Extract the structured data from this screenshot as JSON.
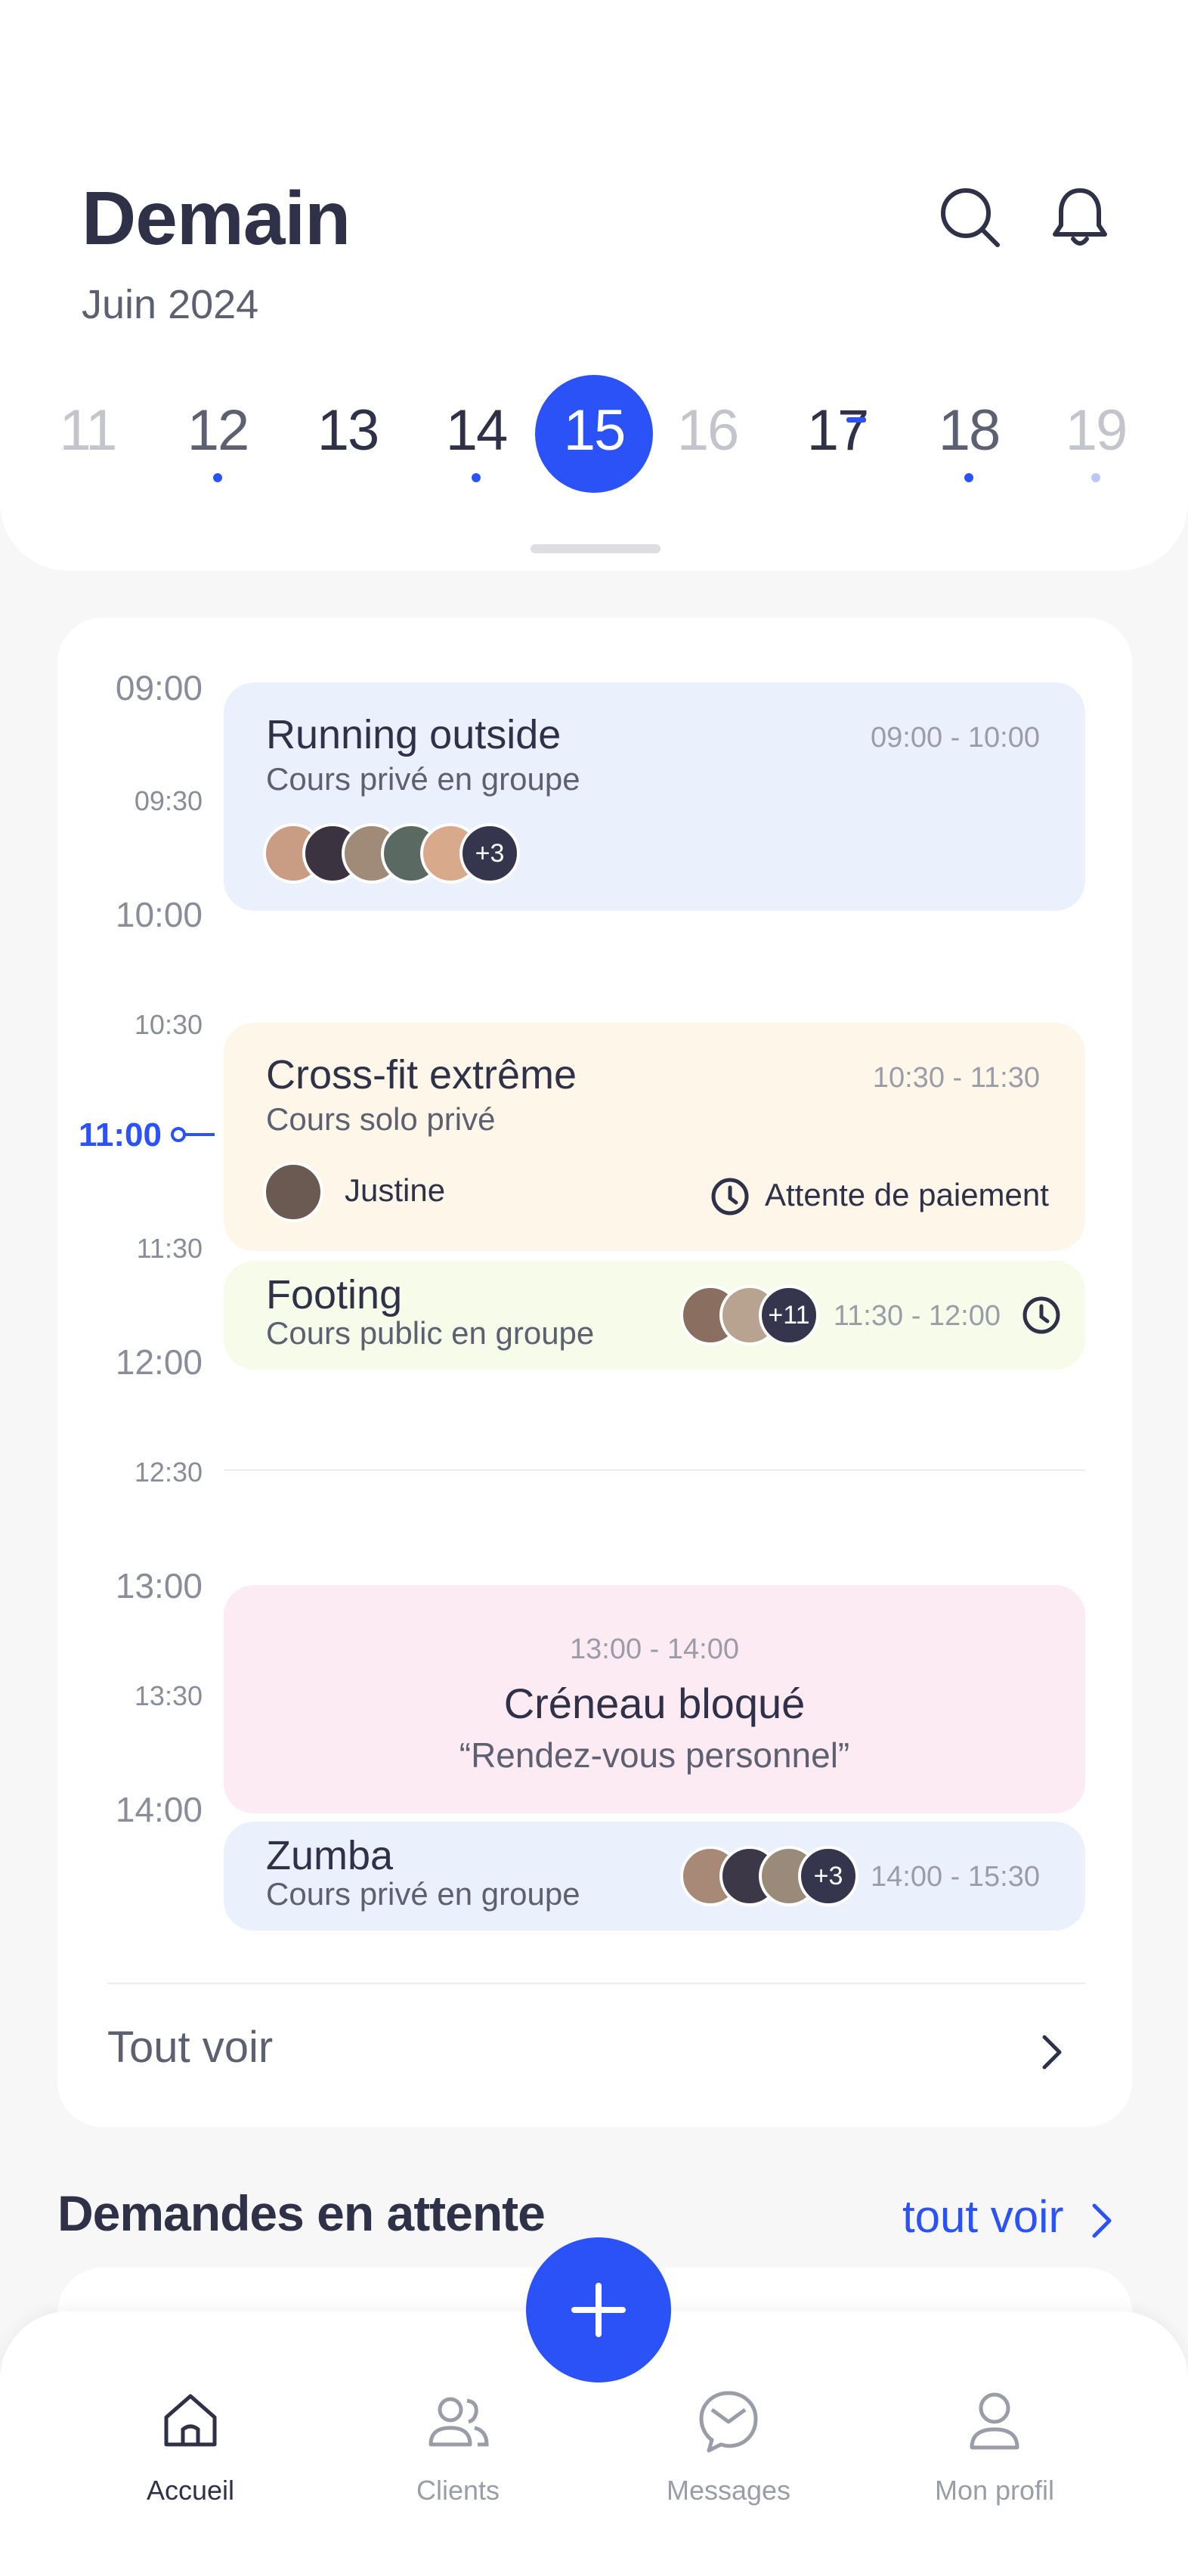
{
  "colors": {
    "accent": "#2b52f6",
    "text_dark": "#2f3148",
    "text_muted": "#5d6070"
  },
  "header": {
    "title": "Demain",
    "subtitle": "Juin 2024",
    "icons": [
      "search-icon",
      "bell-icon"
    ]
  },
  "dates": [
    {
      "day": "11",
      "state": "faded",
      "dot": false
    },
    {
      "day": "12",
      "state": "normal",
      "dot": true
    },
    {
      "day": "13",
      "state": "normal",
      "dot": false
    },
    {
      "day": "14",
      "state": "normal",
      "dot": true
    },
    {
      "day": "15",
      "state": "selected",
      "dot": false
    },
    {
      "day": "16",
      "state": "faded",
      "dot": false
    },
    {
      "day": "17",
      "state": "today",
      "dot": false
    },
    {
      "day": "18",
      "state": "normal",
      "dot": true
    },
    {
      "day": "19",
      "state": "faded",
      "dot": true
    }
  ],
  "schedule": {
    "times": [
      "09:00",
      "09:30",
      "10:00",
      "10:30",
      "11:00",
      "11:30",
      "12:00",
      "12:30",
      "13:00",
      "13:30",
      "14:00"
    ],
    "current_time": "11:00",
    "events": {
      "running": {
        "title": "Running outside",
        "subtitle": "Cours privé en groupe",
        "time": "09:00 - 10:00",
        "extra_count": "+3"
      },
      "crossfit": {
        "title": "Cross-fit extrême",
        "subtitle": "Cours solo privé",
        "time": "10:30 - 11:30",
        "participant": "Justine",
        "status": "Attente de paiement"
      },
      "footing": {
        "title": "Footing",
        "subtitle": "Cours public en groupe",
        "time": "11:30 - 12:00",
        "extra_count": "+11"
      },
      "blocked": {
        "time": "13:00 - 14:00",
        "title": "Créneau bloqué",
        "note": "“Rendez-vous personnel”"
      },
      "zumba": {
        "title": "Zumba",
        "subtitle": "Cours privé en groupe",
        "time": "14:00 - 15:30",
        "extra_count": "+3"
      }
    },
    "see_all": "Tout voir"
  },
  "pending": {
    "title": "Demandes en attente",
    "see_all": "tout voir"
  },
  "nav": {
    "items": [
      {
        "label": "Accueil",
        "icon": "home-icon",
        "active": true
      },
      {
        "label": "Clients",
        "icon": "users-icon",
        "active": false
      },
      {
        "label": "Messages",
        "icon": "message-icon",
        "active": false
      },
      {
        "label": "Mon profil",
        "icon": "user-icon",
        "active": false
      }
    ],
    "fab_icon": "plus-icon"
  }
}
